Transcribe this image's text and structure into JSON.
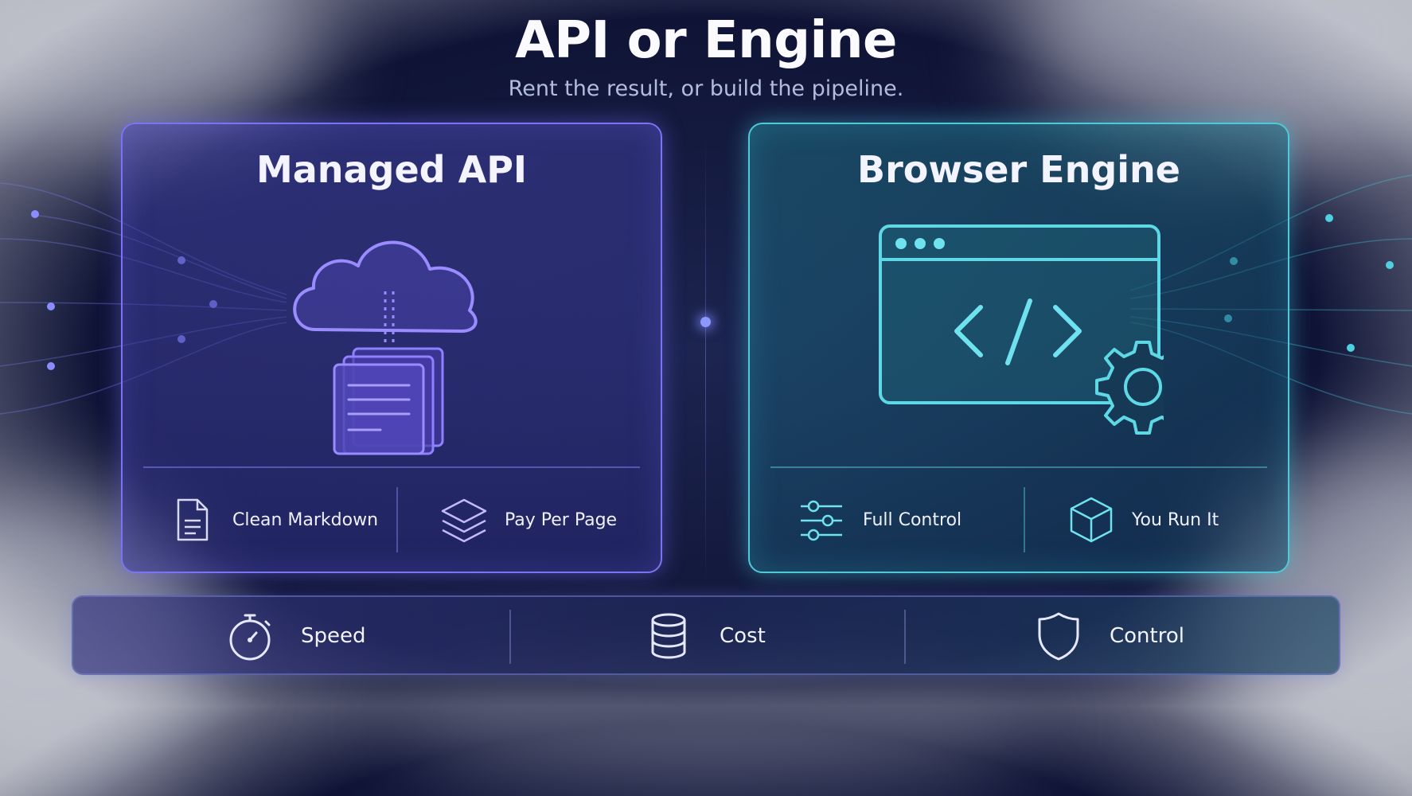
{
  "header": {
    "title": "API or Engine",
    "subtitle": "Rent the result, or build the pipeline."
  },
  "cards": {
    "managed_api": {
      "title": "Managed API",
      "accent": "#7b74f2",
      "illustration": "cloud-documents-icon",
      "features": [
        {
          "label": "Clean Markdown",
          "icon": "document-icon"
        },
        {
          "label": "Pay Per Page",
          "icon": "layers-icon"
        }
      ]
    },
    "browser_engine": {
      "title": "Browser Engine",
      "accent": "#4fc9d8",
      "illustration": "browser-code-gear-icon",
      "features": [
        {
          "label": "Full Control",
          "icon": "sliders-icon"
        },
        {
          "label": "You Run It",
          "icon": "cube-icon"
        }
      ]
    }
  },
  "bottom_bar": {
    "items": [
      {
        "label": "Speed",
        "icon": "stopwatch-icon"
      },
      {
        "label": "Cost",
        "icon": "database-icon"
      },
      {
        "label": "Control",
        "icon": "shield-icon"
      }
    ]
  }
}
